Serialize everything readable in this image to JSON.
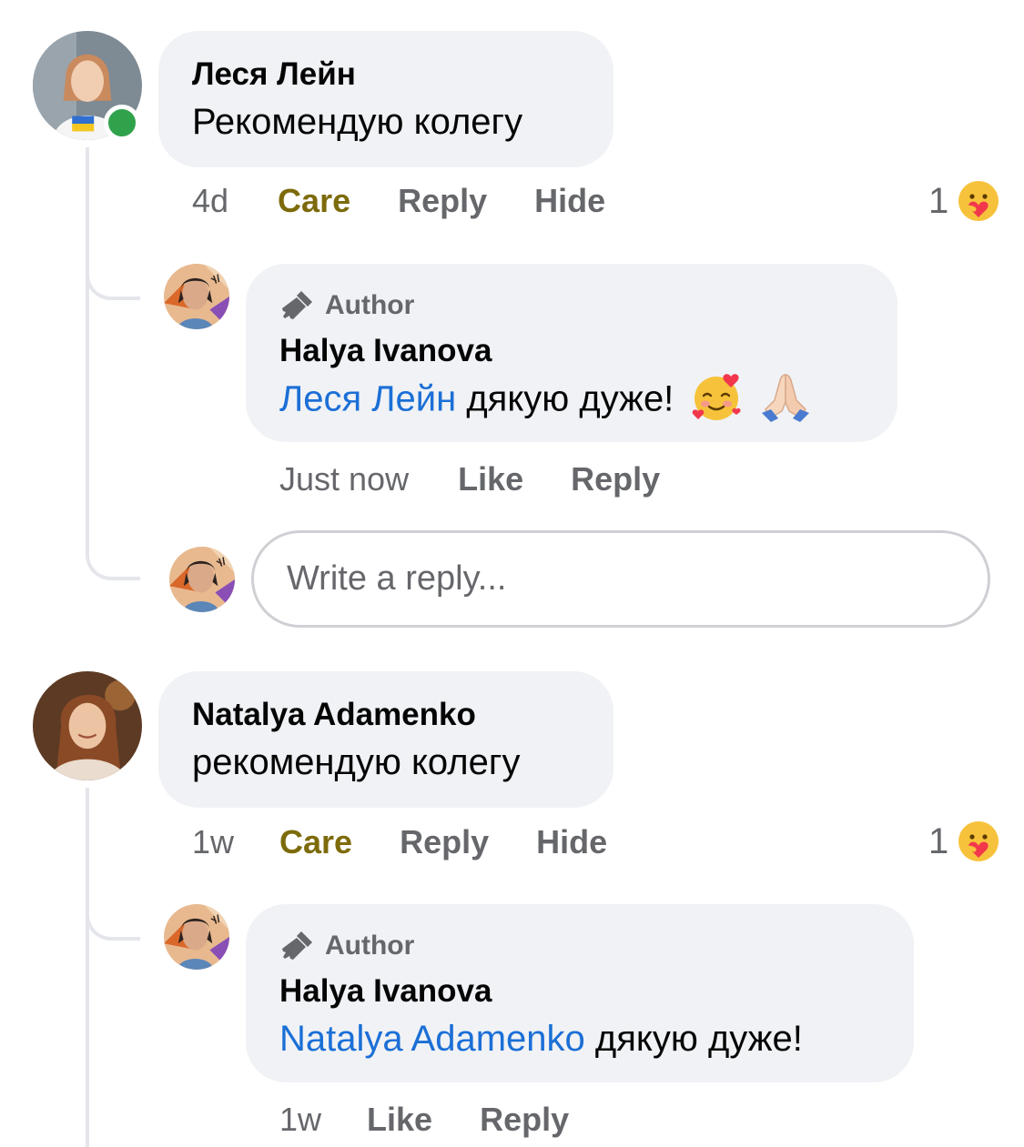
{
  "comments": [
    {
      "author": "Леся Лейн",
      "text": "Рекомендую колегу",
      "time": "4d",
      "reaction_label": "Care",
      "reply_label": "Reply",
      "hide_label": "Hide",
      "reaction_count": "1",
      "online": true,
      "reply": {
        "badge": "Author",
        "author": "Halya Ivanova",
        "mention": "Леся Лейн",
        "text": "дякую дуже!",
        "emojis": [
          "smiling-face-with-hearts",
          "folded-hands"
        ],
        "time": "Just now",
        "like_label": "Like",
        "reply_label": "Reply"
      },
      "write_reply_placeholder": "Write a reply..."
    },
    {
      "author": "Natalya Adamenko",
      "text": "рекомендую колегу",
      "time": "1w",
      "reaction_label": "Care",
      "reply_label": "Reply",
      "hide_label": "Hide",
      "reaction_count": "1",
      "reply": {
        "badge": "Author",
        "author": "Halya Ivanova",
        "mention": "Natalya Adamenko",
        "text": "дякую дуже!",
        "time": "1w",
        "like_label": "Like",
        "reply_label": "Reply"
      }
    }
  ],
  "colors": {
    "bubble": "#f0f2f5",
    "mention": "#1b6fd6",
    "care": "#7d6b0b",
    "meta": "#65676b",
    "online": "#31a24c"
  }
}
